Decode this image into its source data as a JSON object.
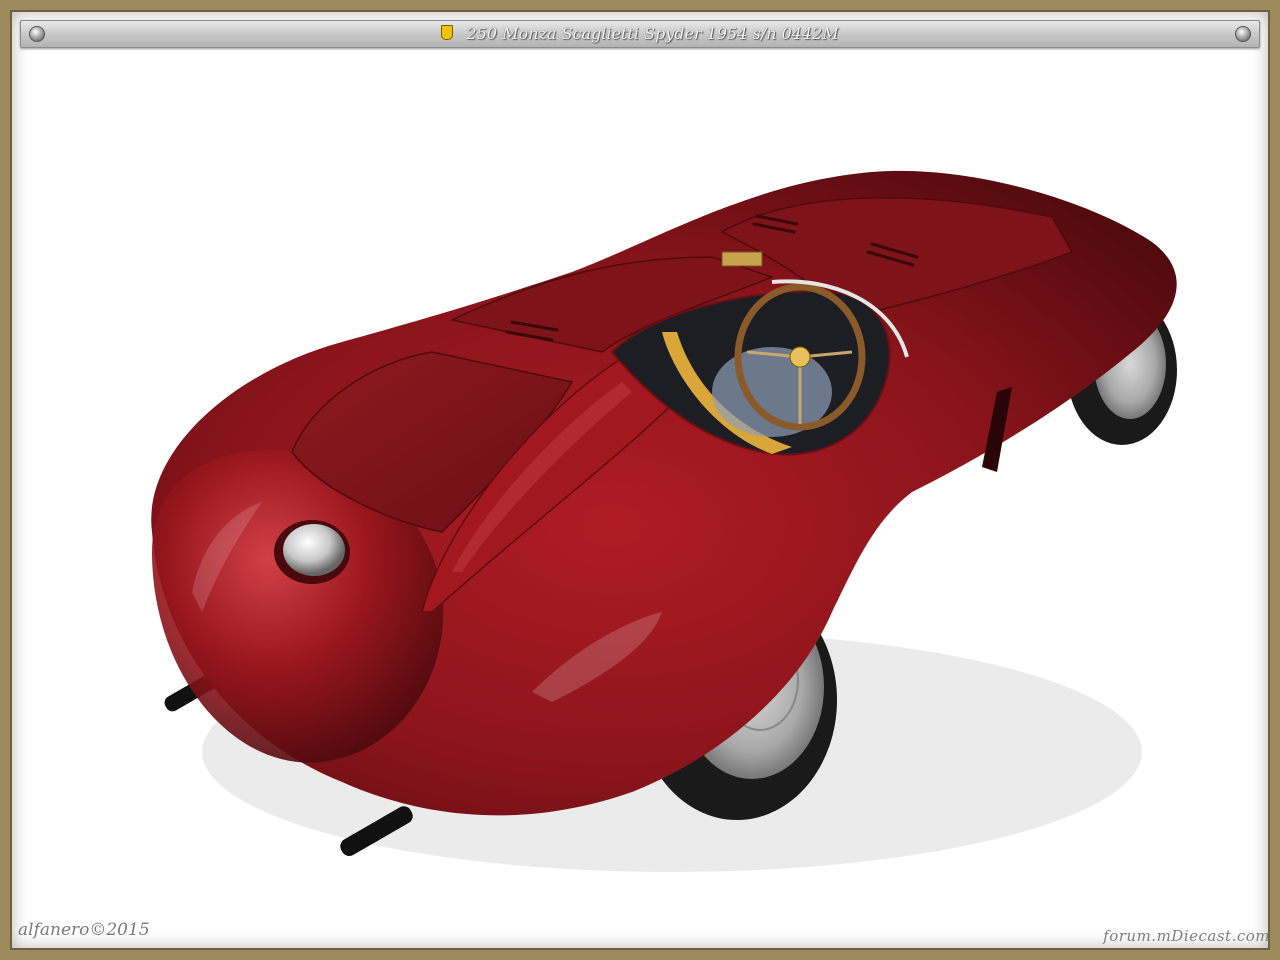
{
  "title_bar": {
    "text": "250 Monza Scaglietti Spyder 1954  s/n 0442M",
    "badge_icon": "prancing-horse-shield-icon"
  },
  "photo": {
    "subject": "red sports car model",
    "body_color": "#7a1218",
    "interior_color": "#d9a63a"
  },
  "footer": {
    "credit": "alfanero©2015",
    "watermark": "forum.mDiecast.com"
  },
  "colors": {
    "frame": "#9c8a5c",
    "title_bar": "#c9c9c9",
    "background": "#ffffff"
  }
}
